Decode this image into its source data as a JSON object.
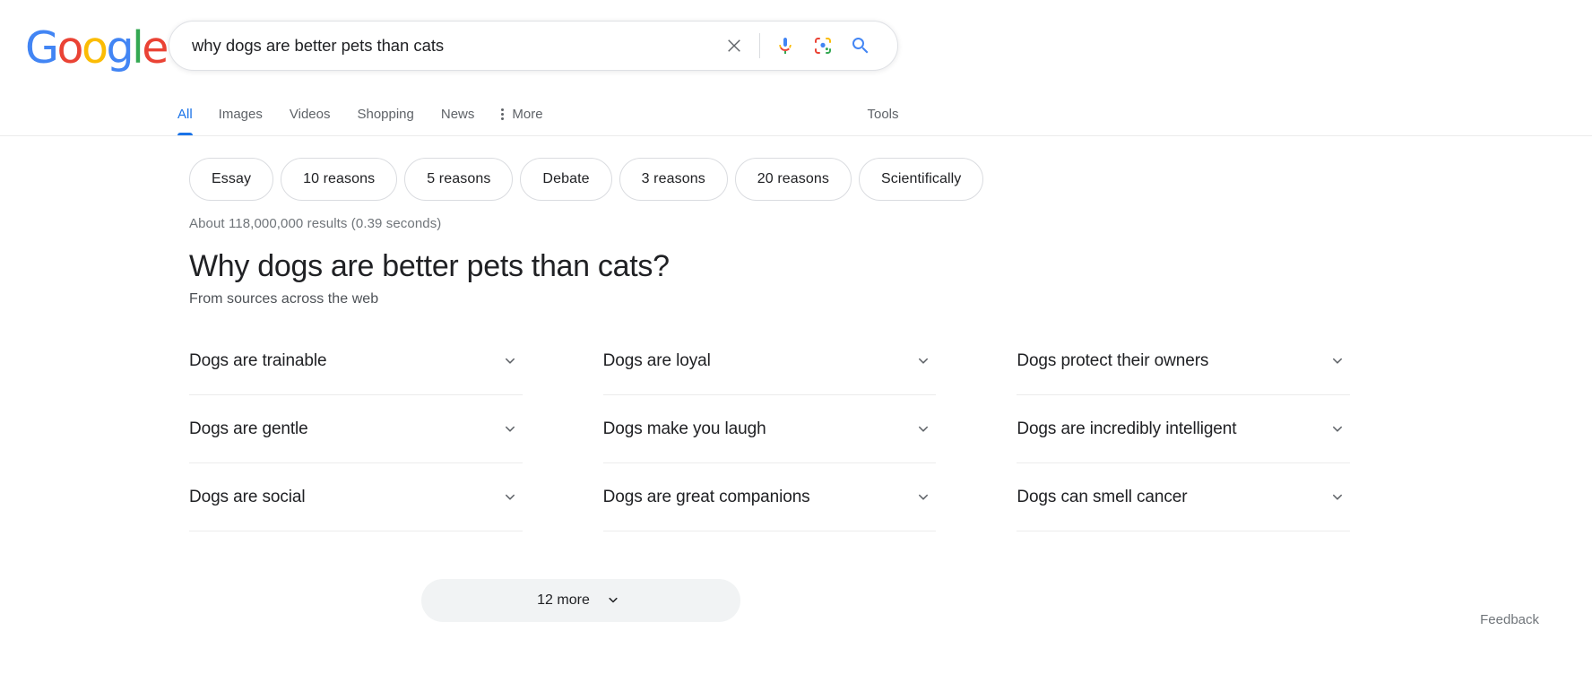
{
  "brand": {
    "logo_text": "Google",
    "logo_letters": [
      {
        "ch": "G",
        "color": "#4285F4"
      },
      {
        "ch": "o",
        "color": "#EA4335"
      },
      {
        "ch": "o",
        "color": "#FBBC05"
      },
      {
        "ch": "g",
        "color": "#4285F4"
      },
      {
        "ch": "l",
        "color": "#34A853"
      },
      {
        "ch": "e",
        "color": "#EA4335"
      }
    ]
  },
  "search": {
    "value": "why dogs are better pets than cats",
    "placeholder": "Search",
    "clear_label": "Clear",
    "voice_label": "Search by voice",
    "lens_label": "Search by image",
    "submit_label": "Google Search"
  },
  "nav": {
    "tabs": [
      {
        "label": "All",
        "active": true
      },
      {
        "label": "Images",
        "active": false
      },
      {
        "label": "Videos",
        "active": false
      },
      {
        "label": "Shopping",
        "active": false
      },
      {
        "label": "News",
        "active": false
      },
      {
        "label": "More",
        "active": false,
        "has_dots": true
      }
    ],
    "tools_label": "Tools",
    "active_color": "#1a73e8"
  },
  "chips": [
    {
      "label": "Essay"
    },
    {
      "label": "10 reasons"
    },
    {
      "label": "5 reasons"
    },
    {
      "label": "Debate"
    },
    {
      "label": "3 reasons"
    },
    {
      "label": "20 reasons"
    },
    {
      "label": "Scientifically"
    }
  ],
  "result_stats": "About 118,000,000 results (0.39 seconds)",
  "panel": {
    "title": "Why dogs are better pets than cats?",
    "subtitle": "From sources across the web",
    "items": [
      {
        "label": "Dogs are trainable"
      },
      {
        "label": "Dogs are loyal"
      },
      {
        "label": "Dogs protect their owners"
      },
      {
        "label": "Dogs are gentle"
      },
      {
        "label": "Dogs make you laugh"
      },
      {
        "label": "Dogs are incredibly intelligent"
      },
      {
        "label": "Dogs are social"
      },
      {
        "label": "Dogs are great companions"
      },
      {
        "label": "Dogs can smell cancer"
      }
    ],
    "more_button": "12 more"
  },
  "feedback_label": "Feedback"
}
